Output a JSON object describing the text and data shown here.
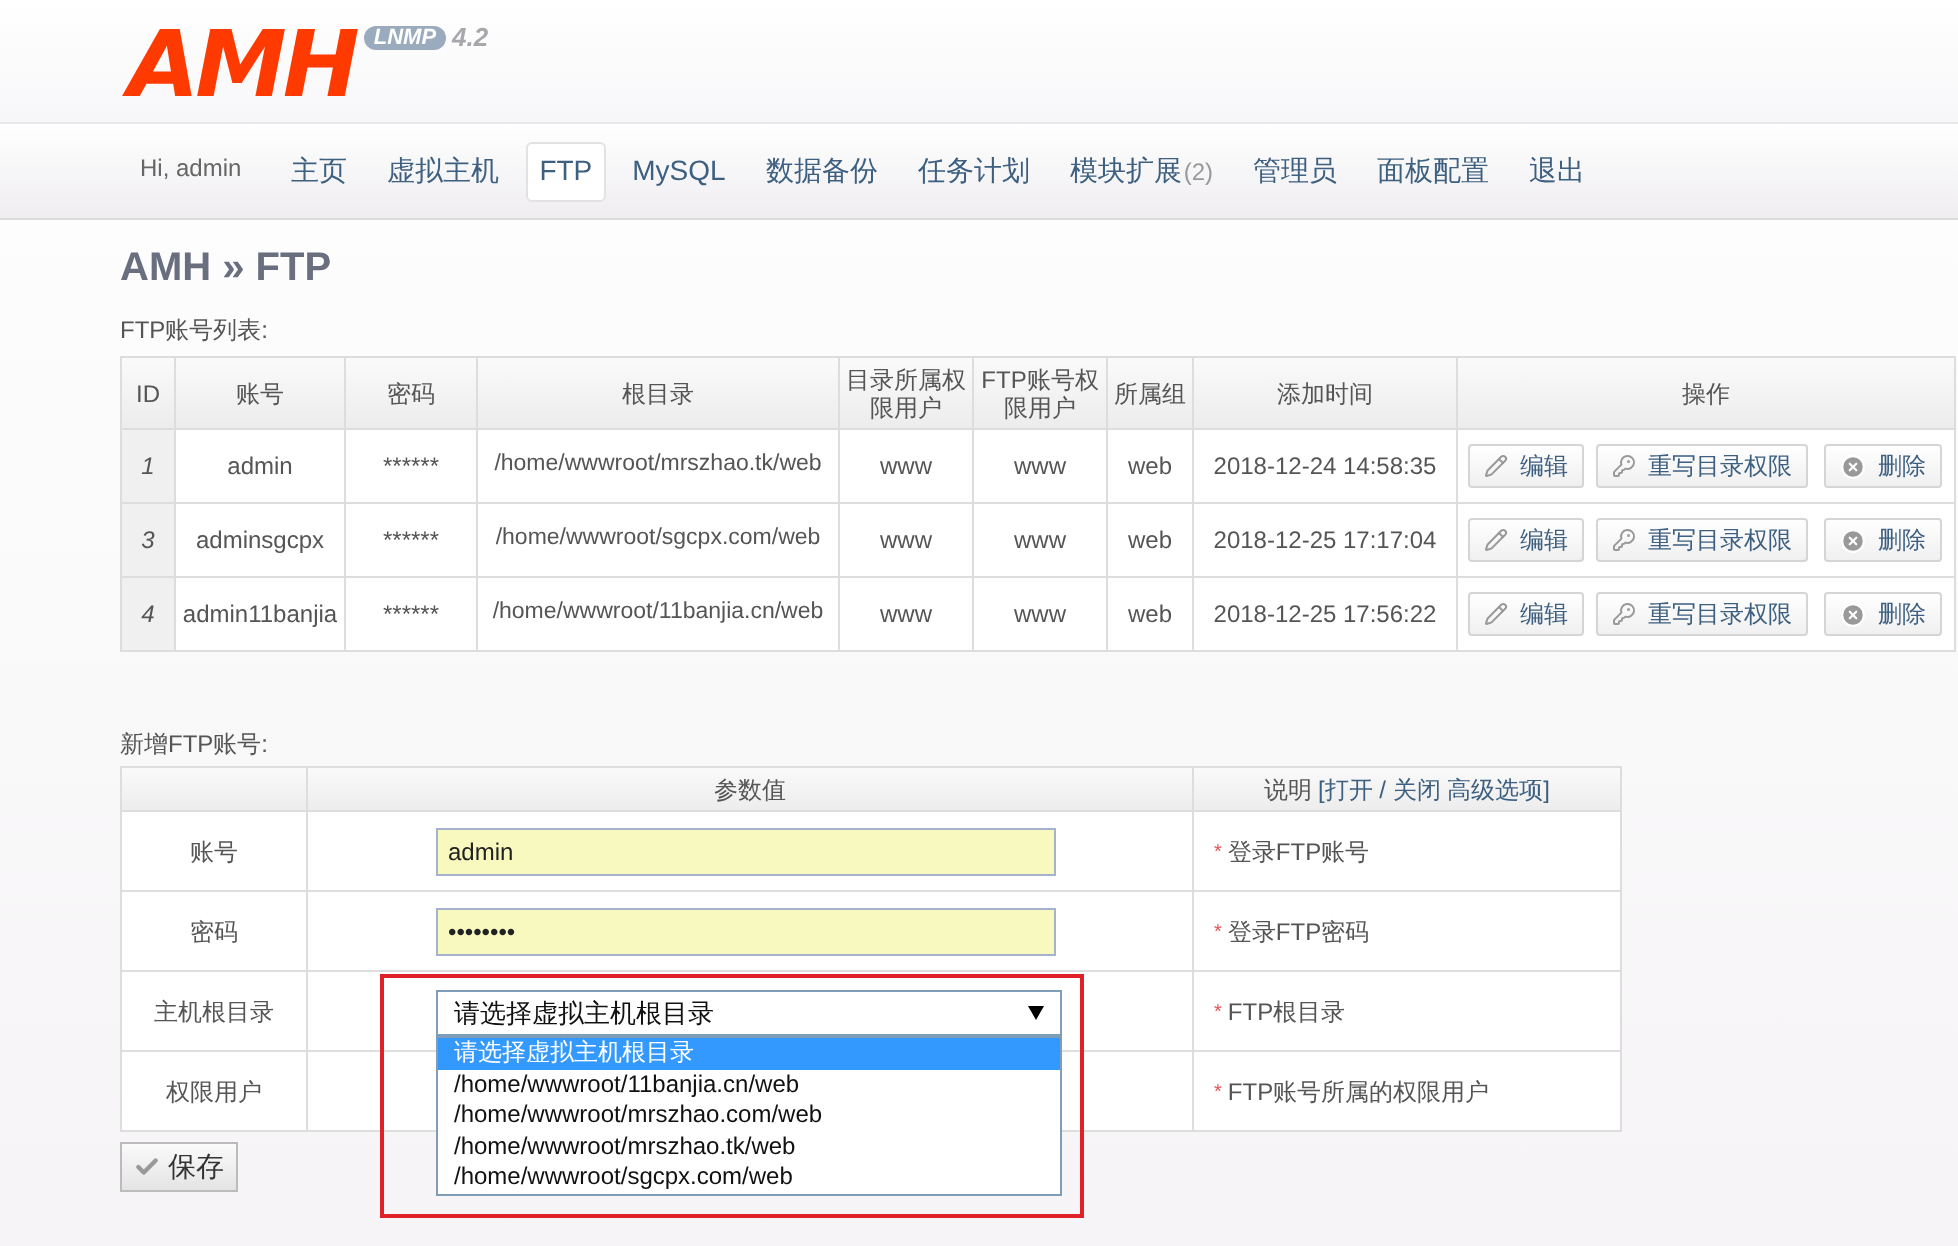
{
  "logo": {
    "name": "AMH",
    "badge": "LNMP",
    "version": "4.2"
  },
  "nav": {
    "greeting": "Hi, admin",
    "items": [
      {
        "label": "主页",
        "selected": false
      },
      {
        "label": "虚拟主机",
        "selected": false
      },
      {
        "label": "FTP",
        "selected": true
      },
      {
        "label": "MySQL",
        "selected": false
      },
      {
        "label": "数据备份",
        "selected": false
      },
      {
        "label": "任务计划",
        "selected": false
      },
      {
        "label": "模块扩展",
        "count": "(2)",
        "selected": false
      },
      {
        "label": "管理员",
        "selected": false
      },
      {
        "label": "面板配置",
        "selected": false
      },
      {
        "label": "退出",
        "selected": false
      }
    ]
  },
  "page_title": "AMH » FTP",
  "accounts": {
    "caption": "FTP账号列表:",
    "columns": [
      "ID",
      "账号",
      "密码",
      "根目录",
      "目录所属权限用户",
      "FTP账号权限用户",
      "所属组",
      "添加时间",
      "操作"
    ],
    "rows": [
      {
        "id": "1",
        "account": "admin",
        "password": "******",
        "root": "/home/wwwroot/mrszhao.tk/web",
        "dir_user": "www",
        "ftp_user": "www",
        "group": "web",
        "added": "2018-12-24 14:58:35",
        "actions": [
          "编辑",
          "重写目录权限",
          "删除"
        ]
      },
      {
        "id": "3",
        "account": "adminsgcpx",
        "password": "******",
        "root": "/home/wwwroot/sgcpx.com/web",
        "dir_user": "www",
        "ftp_user": "www",
        "group": "web",
        "added": "2018-12-25 17:17:04",
        "actions": [
          "编辑",
          "重写目录权限",
          "删除"
        ]
      },
      {
        "id": "4",
        "account": "admin11banjia",
        "password": "******",
        "root": "/home/wwwroot/11banjia.cn/web",
        "dir_user": "www",
        "ftp_user": "www",
        "group": "web",
        "added": "2018-12-25 17:56:22",
        "actions": [
          "编辑",
          "重写目录权限",
          "删除"
        ]
      }
    ]
  },
  "new_account": {
    "caption": "新增FTP账号:",
    "columns": {
      "value": "参数值",
      "desc": "说明",
      "toggle": "[打开 / 关闭 高级选项]"
    },
    "rows": [
      {
        "kind": "text",
        "label": "账号",
        "value": "admin",
        "marker": "*",
        "desc": "登录FTP账号"
      },
      {
        "kind": "password",
        "label": "密码",
        "value": "••••••••",
        "marker": "*",
        "desc": "登录FTP密码"
      },
      {
        "kind": "select",
        "label": "主机根目录",
        "value": "请选择虚拟主机根目录",
        "marker": "*",
        "desc": "FTP根目录",
        "options": [
          {
            "label": "请选择虚拟主机根目录",
            "selected": true
          },
          {
            "label": "/home/wwwroot/11banjia.cn/web",
            "selected": false
          },
          {
            "label": "/home/wwwroot/mrszhao.com/web",
            "selected": false
          },
          {
            "label": "/home/wwwroot/mrszhao.tk/web",
            "selected": false
          },
          {
            "label": "/home/wwwroot/sgcpx.com/web",
            "selected": false
          }
        ]
      },
      {
        "kind": "hidden",
        "label": "权限用户",
        "marker": "*",
        "desc": "FTP账号所属的权限用户"
      }
    ],
    "save": "保存"
  }
}
